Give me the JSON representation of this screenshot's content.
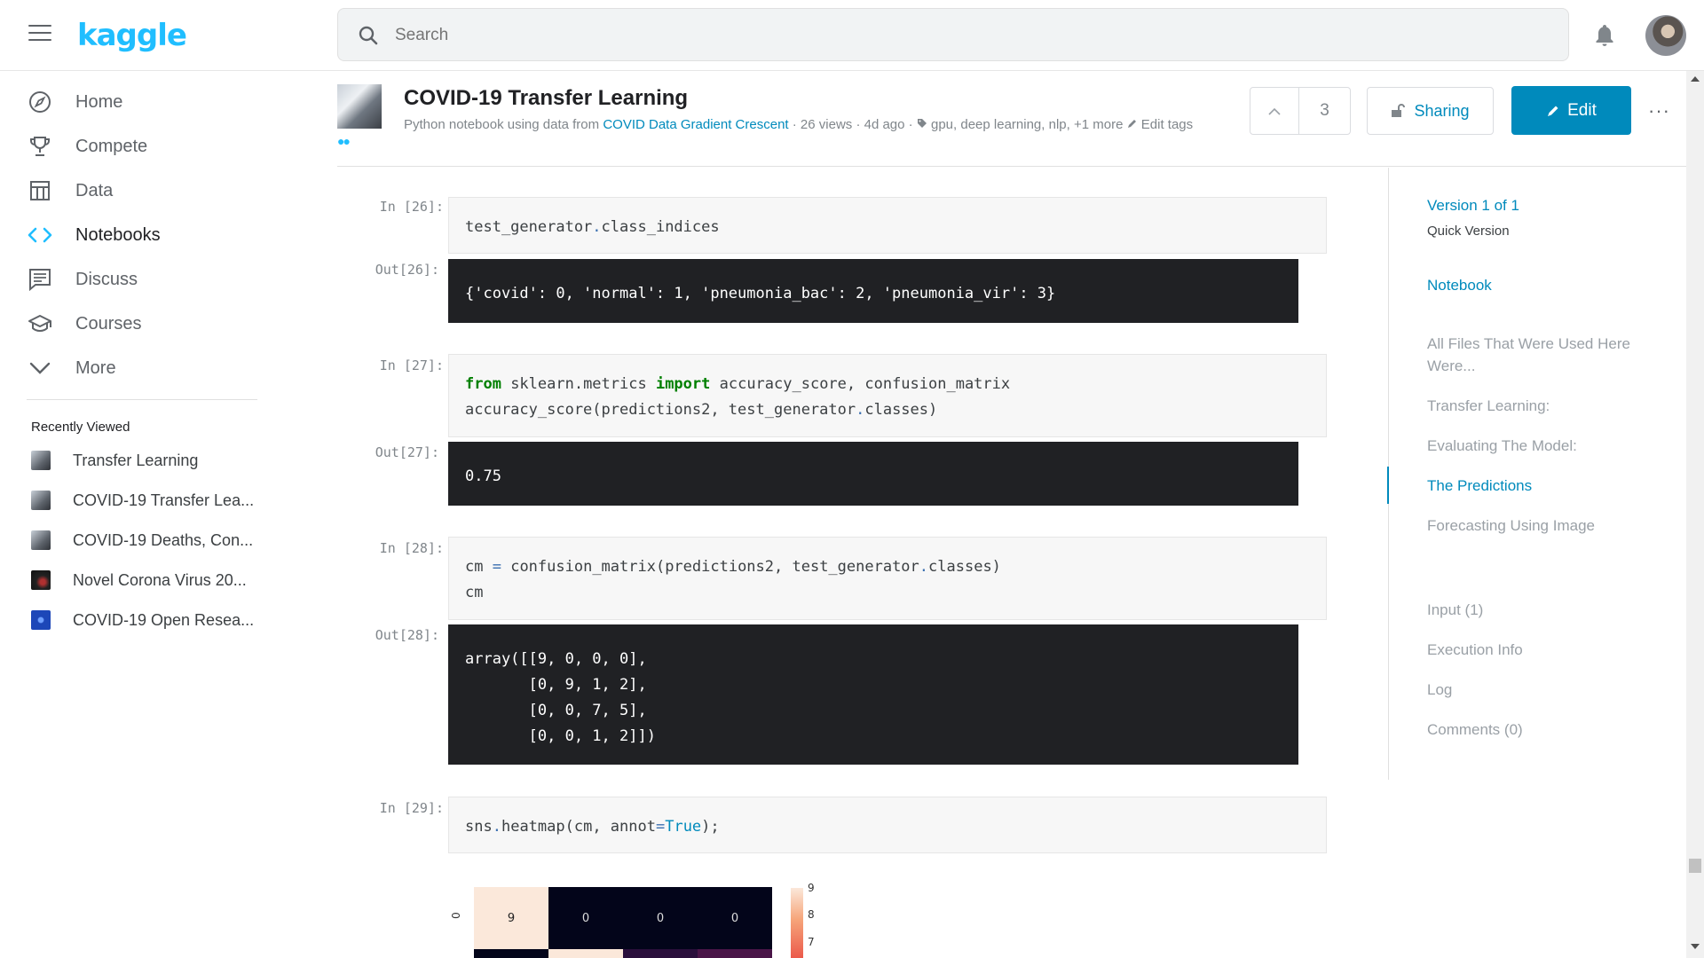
{
  "topbar": {
    "logo": "kaggle",
    "search_placeholder": "Search"
  },
  "nav": {
    "items": [
      {
        "label": "Home",
        "icon": "compass-icon"
      },
      {
        "label": "Compete",
        "icon": "trophy-icon"
      },
      {
        "label": "Data",
        "icon": "table-icon"
      },
      {
        "label": "Notebooks",
        "icon": "code-icon"
      },
      {
        "label": "Discuss",
        "icon": "comment-icon"
      },
      {
        "label": "Courses",
        "icon": "graduation-cap-icon"
      },
      {
        "label": "More",
        "icon": "chevron-down-icon"
      }
    ],
    "active": "Notebooks",
    "recent_title": "Recently Viewed",
    "recent": [
      {
        "label": "Transfer Learning"
      },
      {
        "label": "COVID-19 Transfer Lea..."
      },
      {
        "label": "COVID-19 Deaths, Con..."
      },
      {
        "label": "Novel Corona Virus 20..."
      },
      {
        "label": "COVID-19 Open Resea..."
      }
    ]
  },
  "notebook": {
    "title": "COVID-19 Transfer Learning",
    "meta_prefix": "Python notebook using data from",
    "dataset_link": "COVID Data Gradient Crescent",
    "meta_stats": "· 26 views · 4d ago ·",
    "tags": "gpu, deep learning, nlp,",
    "more_tags": "+1 more",
    "edit_tags": "Edit tags",
    "votes": "3",
    "sharing_label": "Sharing",
    "edit_label": "Edit",
    "more_label": "···"
  },
  "cells": [
    {
      "in_prompt": "In [26]:",
      "out_prompt": "Out[26]:",
      "output": "{'covid': 0, 'normal': 1, 'pneumonia_bac': 2, 'pneumonia_vir': 3}"
    },
    {
      "in_prompt": "In [27]:",
      "out_prompt": "Out[27]:",
      "output": "0.75"
    },
    {
      "in_prompt": "In [28]:",
      "out_prompt": "Out[28]:",
      "output": "array([[9, 0, 0, 0],\n       [0, 9, 1, 2],\n       [0, 0, 7, 5],\n       [0, 0, 1, 2]])"
    },
    {
      "in_prompt": "In [29]:"
    }
  ],
  "heatmap": {
    "row0": [
      "9",
      "0",
      "0",
      "0"
    ],
    "ytick": "0",
    "colorbar_ticks": [
      "9",
      "8",
      "7"
    ],
    "colors": {
      "high": "#fbe8da",
      "low": "#03051a",
      "mid": "#2a0f3c",
      "mid2": "#4a1548"
    }
  },
  "toc": {
    "version": "Version 1 of 1",
    "version_sub": "Quick Version",
    "items": [
      {
        "label": "Notebook"
      },
      {
        "label": "All Files That Were Used Here Were..."
      },
      {
        "label": "Transfer Learning:"
      },
      {
        "label": "Evaluating The Model:"
      },
      {
        "label": "The Predictions"
      },
      {
        "label": "Forecasting Using Image"
      },
      {
        "label": "Input (1)"
      },
      {
        "label": "Execution Info"
      },
      {
        "label": "Log"
      },
      {
        "label": "Comments (0)"
      }
    ]
  },
  "colors": {
    "accent": "#20beff",
    "link": "#008abc",
    "edit_button": "#008abc",
    "output_bg": "#202124"
  }
}
